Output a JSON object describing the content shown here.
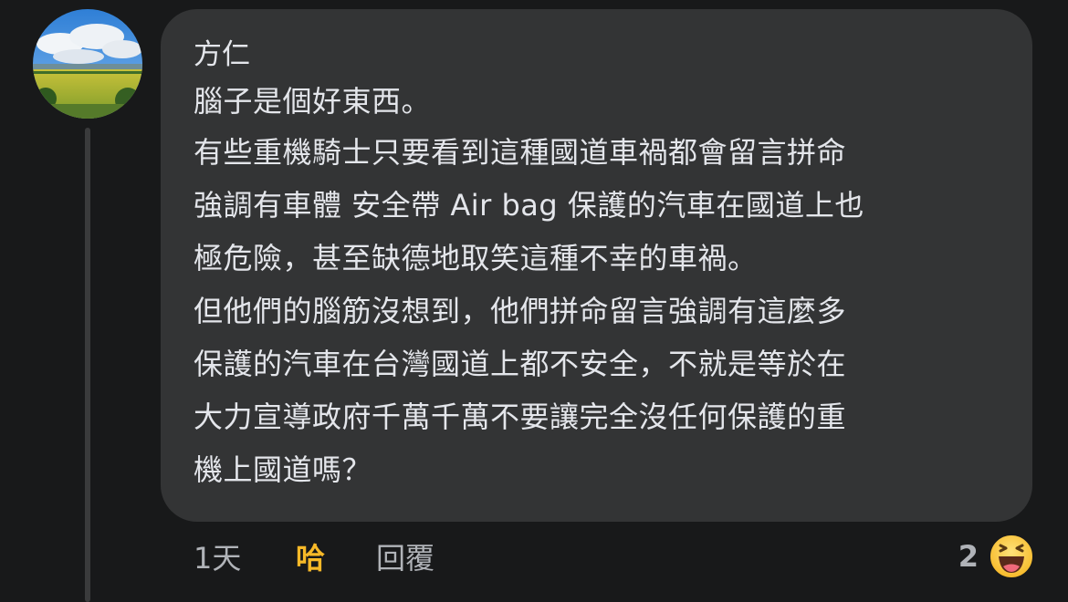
{
  "comment": {
    "author": "方仁",
    "lines": [
      "腦子是個好東西。",
      "有些重機騎士只要看到這種國道車禍都會留言拼命",
      "強調有車體 安全帶 Air bag 保護的汽車在國道上也",
      "極危險，甚至缺德地取笑這種不幸的車禍。",
      "但他們的腦筋沒想到，他們拼命留言強調有這麼多",
      "保護的汽車在台灣國道上都不安全，不就是等於在",
      "大力宣導政府千萬千萬不要讓完全沒任何保護的重",
      "機上國道嗎？"
    ]
  },
  "actions": {
    "time": "1天",
    "react": "哈",
    "reply": "回覆"
  },
  "reactions": {
    "count": "2",
    "emoji_icon": "haha-emoji-icon"
  }
}
